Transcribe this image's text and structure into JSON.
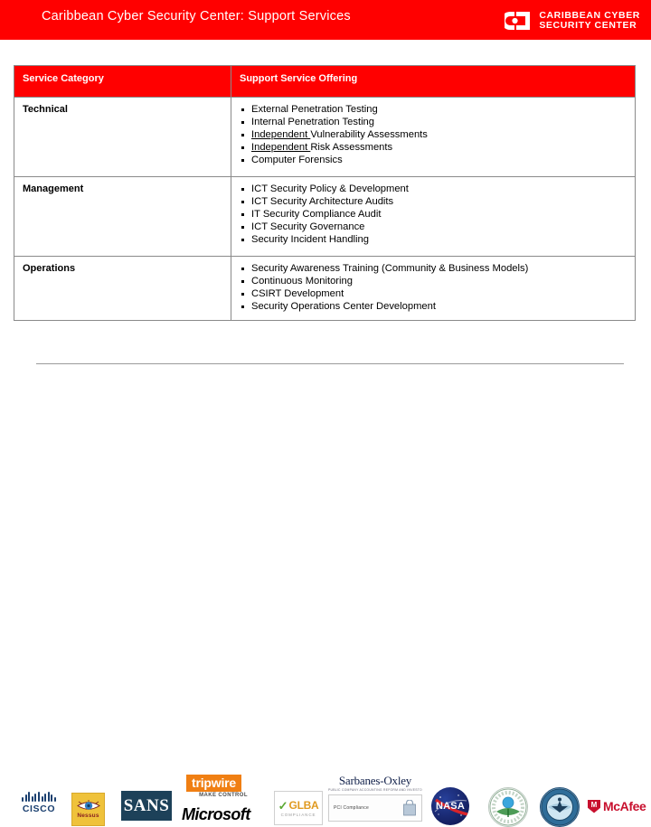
{
  "header": {
    "title": "Caribbean Cyber Security Center: Support Services",
    "accent_color": "#FF0000",
    "brand": {
      "line1": "CARIBBEAN CYBER",
      "line2": "SECURITY CENTER",
      "mark": "ccsc-logo-mark"
    }
  },
  "table": {
    "columns": [
      "Service Category",
      "Support Service Offering"
    ],
    "rows": [
      {
        "category": "Technical",
        "offerings": [
          {
            "text": "External Penetration Testing",
            "underlined_prefix": ""
          },
          {
            "text": "Internal  Penetration Testing",
            "underlined_prefix": ""
          },
          {
            "text": "Independent Vulnerability Assessments",
            "underlined_prefix": "Independent "
          },
          {
            "text": "Independent Risk Assessments",
            "underlined_prefix": "Independent "
          },
          {
            "text": "Computer Forensics",
            "underlined_prefix": ""
          }
        ]
      },
      {
        "category": "Management",
        "offerings": [
          {
            "text": "ICT Security Policy & Development",
            "underlined_prefix": ""
          },
          {
            "text": "ICT Security Architecture Audits",
            "underlined_prefix": ""
          },
          {
            "text": "IT Security Compliance Audit",
            "underlined_prefix": ""
          },
          {
            "text": "ICT Security Governance",
            "underlined_prefix": ""
          },
          {
            "text": "Security Incident Handling",
            "underlined_prefix": ""
          }
        ]
      },
      {
        "category": "Operations",
        "offerings": [
          {
            "text": "Security Awareness Training (Community & Business Models)",
            "underlined_prefix": ""
          },
          {
            "text": "Continuous Monitoring",
            "underlined_prefix": ""
          },
          {
            "text": "CSIRT Development",
            "underlined_prefix": ""
          },
          {
            "text": "Security Operations Center Development",
            "underlined_prefix": ""
          }
        ]
      }
    ]
  },
  "logos": {
    "cisco": {
      "name": "cisco-logo",
      "word": "CISCO",
      "color": "#1a3f6f"
    },
    "nessus": {
      "name": "nessus-logo",
      "word": "Nessus",
      "bg": "#EFC23B"
    },
    "sans": {
      "name": "sans-institute-logo",
      "word": "SANS",
      "bg": "#1d4159"
    },
    "tripwire": {
      "name": "tripwire-logo",
      "word": "tripwire",
      "tagline": "MAKE CONTROL",
      "color": "#F07F13"
    },
    "microsoft": {
      "name": "microsoft-logo",
      "word": "Microsoft"
    },
    "glba": {
      "name": "glba-compliance-logo",
      "word": "GLBA",
      "sub": "COMPLIANCE",
      "color": "#E09A20"
    },
    "sox": {
      "name": "sarbanes-oxley-logo",
      "word": "Sarbanes-Oxley",
      "sub": "PUBLIC COMPANY ACCOUNTING REFORM AND INVESTOR PROTECTION ACT",
      "pci_label": "PCI Compliance"
    },
    "nasa": {
      "name": "nasa-logo",
      "word": "NASA"
    },
    "epa": {
      "name": "epa-seal-logo",
      "word": ""
    },
    "dod": {
      "name": "dod-seal-logo",
      "word": ""
    },
    "mcafee": {
      "name": "mcafee-logo",
      "word": "McAfee",
      "color": "#C8102E"
    }
  }
}
